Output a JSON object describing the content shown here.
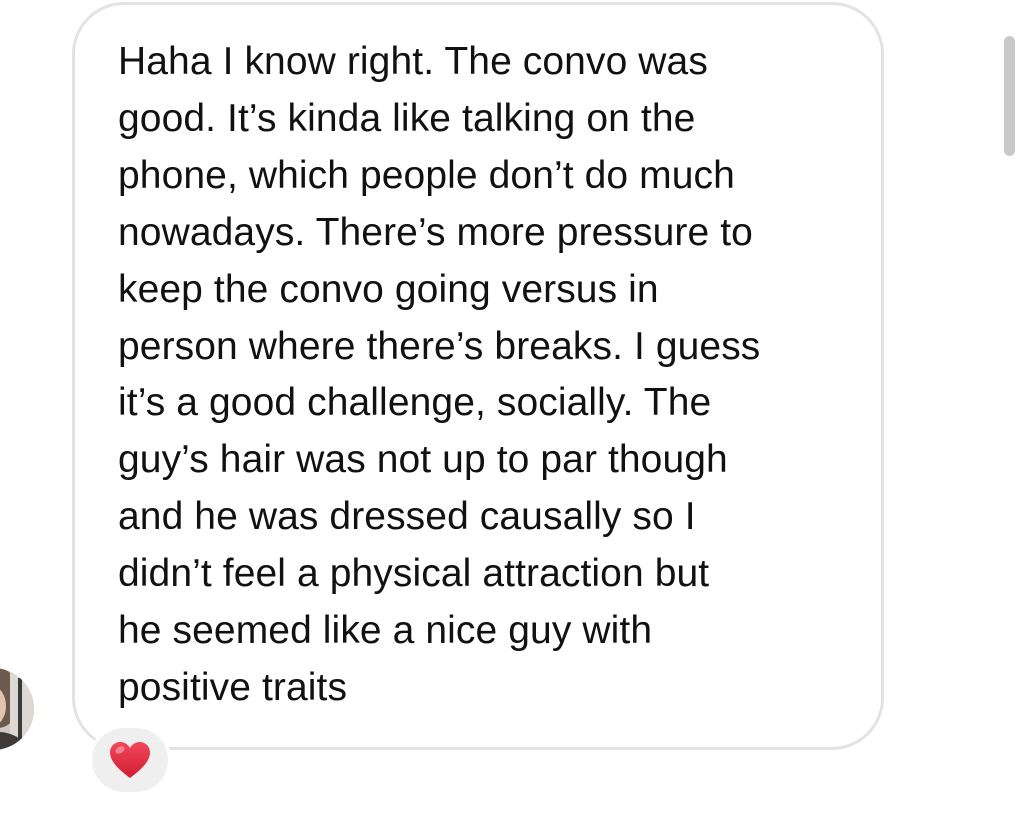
{
  "message": {
    "lines": [
      "Haha I know right. The convo was",
      "good. It’s kinda like talking on the",
      "phone, which people don’t do much",
      "nowadays. There’s more pressure to",
      "keep the convo going versus in",
      "person where there’s breaks. I guess",
      "it’s a good challenge, socially. The",
      "guy’s hair was not up to par though",
      "and he was dressed causally so I",
      "didn’t feel a physical attraction but",
      "he seemed like a nice guy with",
      "positive traits"
    ]
  },
  "reaction": {
    "icon": "heart-icon",
    "color": "#e0243b"
  },
  "colors": {
    "bubble_border": "#e3e3e3",
    "text": "#111111",
    "reaction_bg": "#efefef",
    "scrollbar": "#c9c9c9"
  }
}
